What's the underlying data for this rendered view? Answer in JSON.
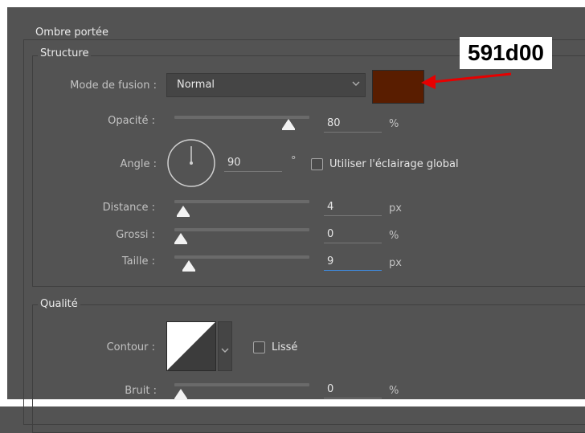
{
  "panel": {
    "title": "Ombre portée",
    "structure_title": "Structure",
    "quality_title": "Qualité"
  },
  "structure": {
    "blend_mode": {
      "label": "Mode de fusion :",
      "value": "Normal"
    },
    "color": {
      "hex": "#591d00"
    },
    "opacity": {
      "label": "Opacité :",
      "value": "80",
      "unit": "%",
      "level": 0.8
    },
    "angle": {
      "label": "Angle :",
      "value": "90",
      "unit": "°",
      "degrees": 90
    },
    "global_light": {
      "label": "Utiliser l'éclairage global",
      "checked": false
    },
    "distance": {
      "label": "Distance :",
      "value": "4",
      "unit": "px",
      "level": 0.02
    },
    "spread": {
      "label": "Grossi :",
      "value": "0",
      "unit": "%",
      "level": 0.0
    },
    "size": {
      "label": "Taille :",
      "value": "9",
      "unit": "px",
      "level": 0.06
    }
  },
  "quality": {
    "contour": {
      "label": "Contour :"
    },
    "antialias": {
      "label": "Lissé",
      "checked": false
    },
    "noise": {
      "label": "Bruit :",
      "value": "0",
      "unit": "%",
      "level": 0.0
    }
  },
  "annotation": {
    "text": "591d00",
    "arrow_color": "#e60000"
  },
  "icons": {
    "dropdown": "chevron-down-icon",
    "angle_dial": "angle-dial-icon"
  }
}
